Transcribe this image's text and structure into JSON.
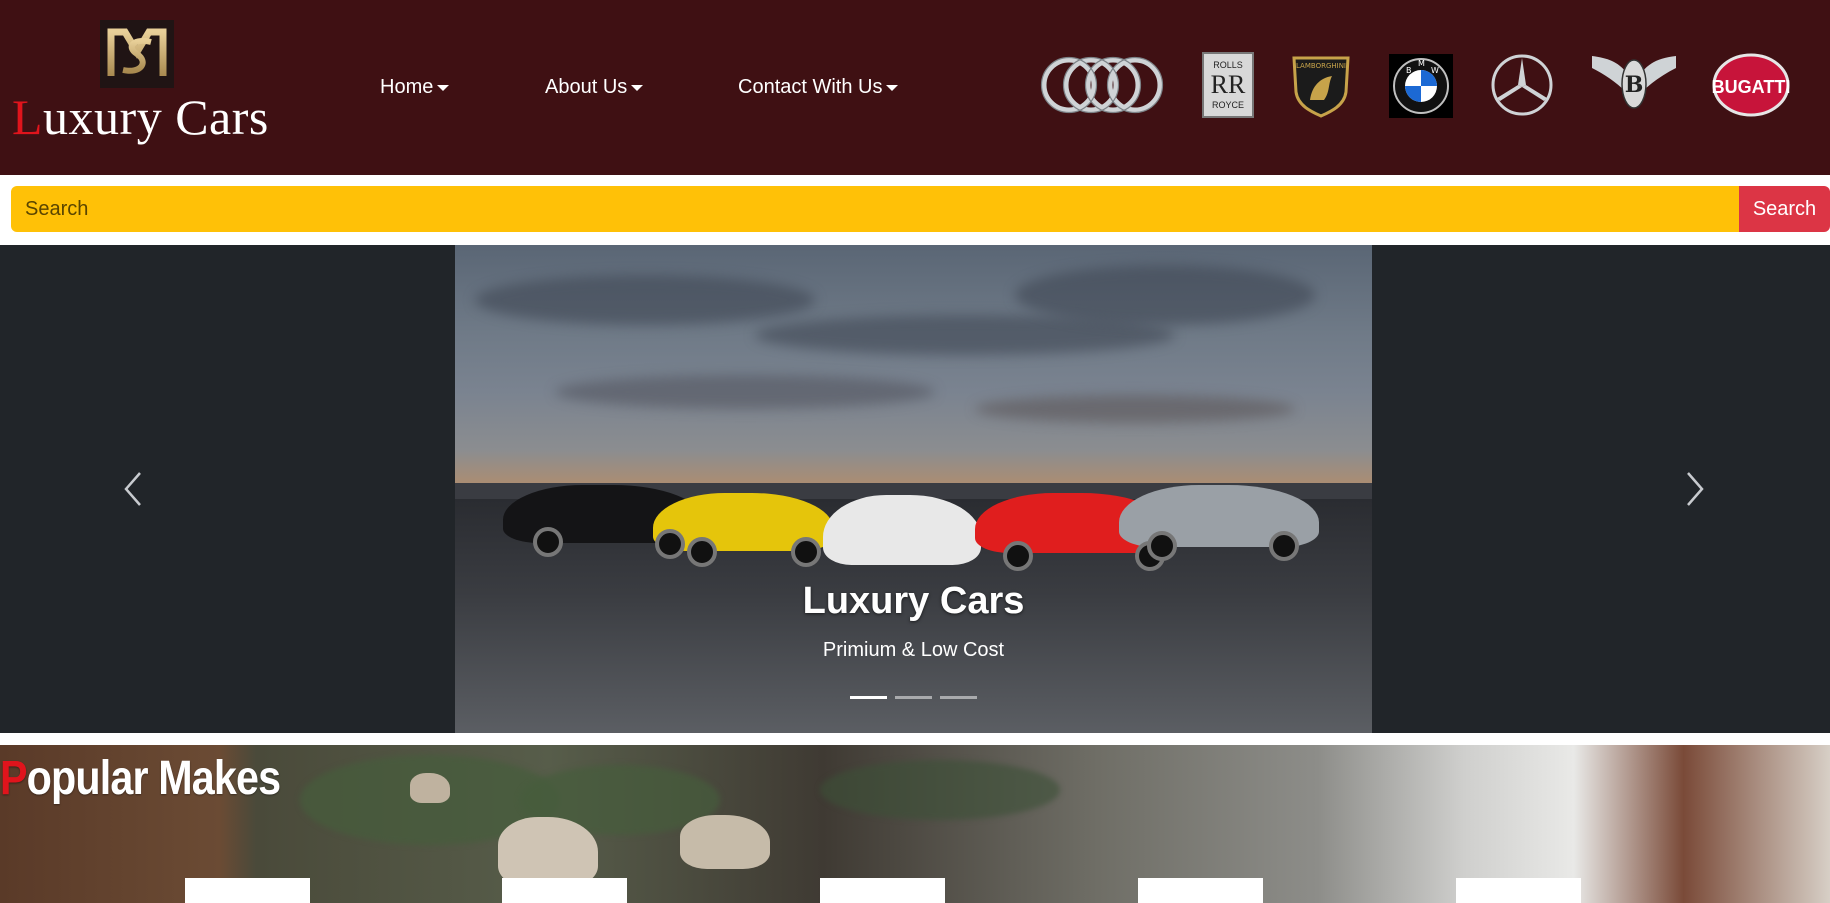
{
  "header": {
    "brand_first_letter": "L",
    "brand_rest": "uxury Cars",
    "logo_icon": "ms-monogram-logo",
    "nav": [
      {
        "label": "Home"
      },
      {
        "label": "About Us"
      },
      {
        "label": "Contact With Us"
      }
    ],
    "makes_logos": [
      {
        "name": "audi-logo"
      },
      {
        "name": "rolls-royce-logo",
        "text_top": "ROLLS",
        "monogram": "RR",
        "text_bottom": "ROYCE"
      },
      {
        "name": "lamborghini-logo",
        "text": "LAMBORGHINI"
      },
      {
        "name": "bmw-logo",
        "letters": "B M W"
      },
      {
        "name": "mercedes-logo"
      },
      {
        "name": "bentley-logo",
        "letter": "B"
      },
      {
        "name": "bugatti-logo",
        "text": "BUGATTI"
      }
    ]
  },
  "search": {
    "placeholder": "Search",
    "button_label": "Search",
    "input_color": "#ffc107",
    "button_color": "#dc3545"
  },
  "carousel": {
    "caption_title": "Luxury Cars",
    "caption_subtitle": "Primium & Low Cost",
    "slides_count": 3,
    "active_index": 0,
    "prev_icon": "chevron-left-icon",
    "next_icon": "chevron-right-icon"
  },
  "popular": {
    "title_first_letter": "P",
    "title_rest": "opular Makes"
  },
  "colors": {
    "header_bg": "#3f1013",
    "accent_red": "#e0141c",
    "carousel_bg": "#212529"
  }
}
